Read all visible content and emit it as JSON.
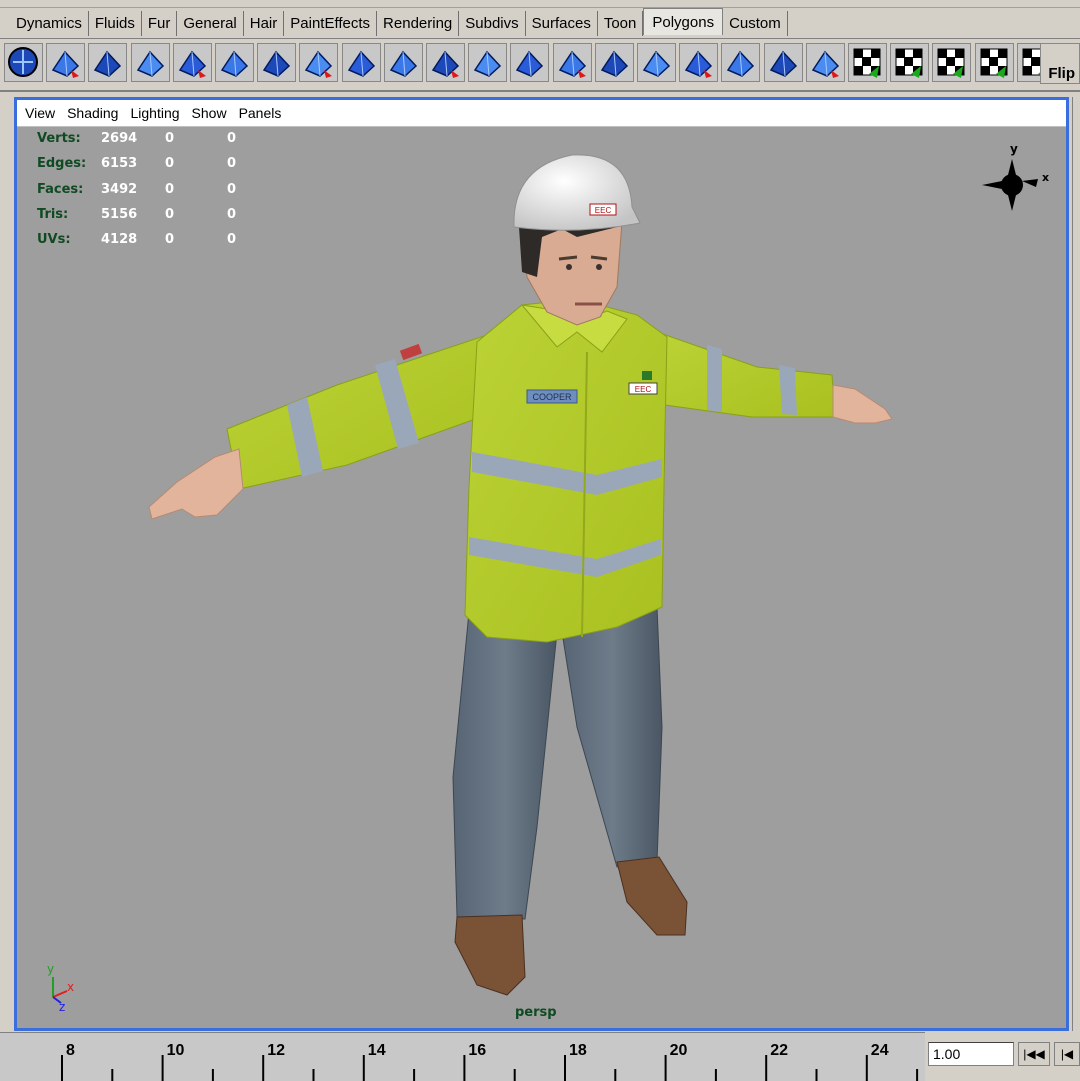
{
  "shelf_tabs": [
    "Dynamics",
    "Fluids",
    "Fur",
    "General",
    "Hair",
    "PaintEffects",
    "Rendering",
    "Subdivs",
    "Surfaces",
    "Toon",
    "Polygons",
    "Custom"
  ],
  "active_tab": "Polygons",
  "shelf_tools": [
    "polygon-sphere-icon",
    "extract-icon",
    "separate-icon",
    "combine-icon",
    "cube-icon",
    "split-polygon-icon",
    "select-faces-icon",
    "extrude-face-icon",
    "extrude-edge-icon",
    "poke-face-icon",
    "bevel-icon",
    "duplicate-face-icon",
    "wedge-face-icon",
    "bridge-icon",
    "merge-vertices-icon",
    "triangulate-icon",
    "append-polygon-icon",
    "smooth-icon",
    "sculpt-icon",
    "planar-mapping-icon",
    "cylindrical-mapping-icon",
    "spherical-mapping-icon",
    "automatic-mapping-icon",
    "uv-editor-icon",
    "checker-uv-icon"
  ],
  "flip_label": "Flip",
  "panel_menu": [
    "View",
    "Shading",
    "Lighting",
    "Show",
    "Panels"
  ],
  "hud": [
    {
      "label": "Verts:",
      "v1": "2694",
      "v2": "0",
      "v3": "0"
    },
    {
      "label": "Edges:",
      "v1": "6153",
      "v2": "0",
      "v3": "0"
    },
    {
      "label": "Faces:",
      "v1": "3492",
      "v2": "0",
      "v3": "0"
    },
    {
      "label": "Tris:",
      "v1": "5156",
      "v2": "0",
      "v3": "0"
    },
    {
      "label": "UVs:",
      "v1": "4128",
      "v2": "0",
      "v3": "0"
    }
  ],
  "camera_label": "persp",
  "name_tag": "COOPER",
  "badge_text": "EEC",
  "axis_labels": {
    "x": "x",
    "y": "y",
    "z": "z"
  },
  "timeline_ticks": [
    "8",
    "10",
    "12",
    "14",
    "16",
    "18",
    "20",
    "22",
    "24"
  ],
  "current_frame": "1.00",
  "colors": {
    "viewport_bg": "#9e9e9e",
    "viewport_border": "#3a6edc",
    "hud_label": "#0f4a22",
    "jacket": "#b5cc2a",
    "reflective_strip": "#9aa7b8"
  }
}
